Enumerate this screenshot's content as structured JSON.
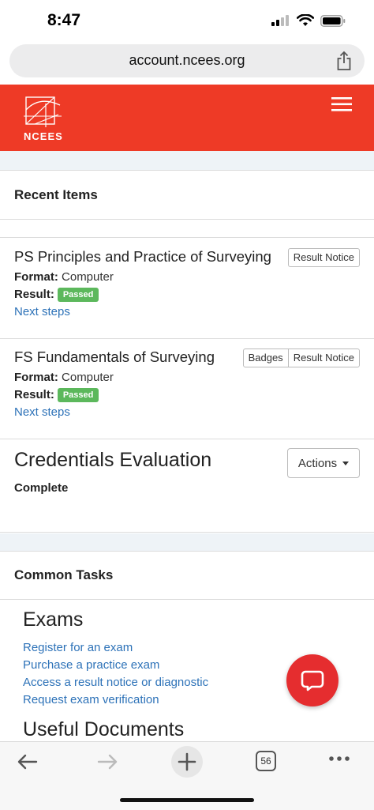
{
  "status": {
    "time": "8:47"
  },
  "browser": {
    "url": "account.ncees.org",
    "tab_count": "56"
  },
  "header": {
    "logo_text": "NCEES"
  },
  "recent": {
    "heading": "Recent Items",
    "items": [
      {
        "title": "PS Principles and Practice of Surveying",
        "format_label": "Format:",
        "format": "Computer",
        "result_label": "Result:",
        "result": "Passed",
        "link": "Next steps",
        "buttons": [
          "Result Notice"
        ]
      },
      {
        "title": "FS Fundamentals of Surveying",
        "format_label": "Format:",
        "format": "Computer",
        "result_label": "Result:",
        "result": "Passed",
        "link": "Next steps",
        "buttons": [
          "Badges",
          "Result Notice"
        ]
      }
    ]
  },
  "credentials": {
    "title": "Credentials Evaluation",
    "status": "Complete",
    "actions_label": "Actions"
  },
  "common_tasks": {
    "heading": "Common Tasks",
    "exams_heading": "Exams",
    "exam_links": [
      "Register for an exam",
      "Purchase a practice exam",
      "Access a result notice or diagnostic",
      "Request exam verification"
    ],
    "documents_heading": "Useful Documents"
  },
  "colors": {
    "brand_red": "#ee3a26",
    "link_blue": "#2d72b8",
    "passed_green": "#5cb85c",
    "chat_red": "#e52d2f"
  }
}
